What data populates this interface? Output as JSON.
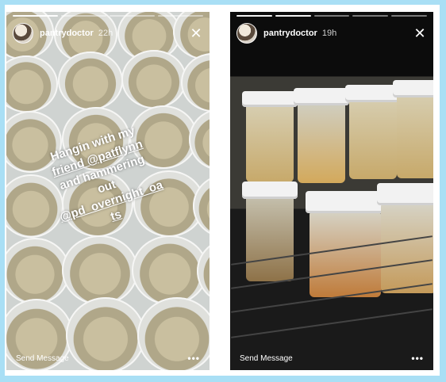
{
  "stories": [
    {
      "username": "pantrydoctor",
      "time": "22h",
      "caption_lines": [
        "Hangin with my",
        "friend @patflynn",
        "and hammering",
        "out",
        "@pd_overnight_oa",
        "ts"
      ],
      "send_label": "Send Message",
      "more_label": "•••",
      "progress_segments": 4,
      "progress_done": 1
    },
    {
      "username": "pantrydoctor",
      "time": "19h",
      "send_label": "Send Message",
      "more_label": "•••",
      "progress_segments": 5,
      "progress_done": 2
    }
  ],
  "icons": {
    "close": "close-icon",
    "more": "more-icon",
    "avatar": "avatar"
  }
}
